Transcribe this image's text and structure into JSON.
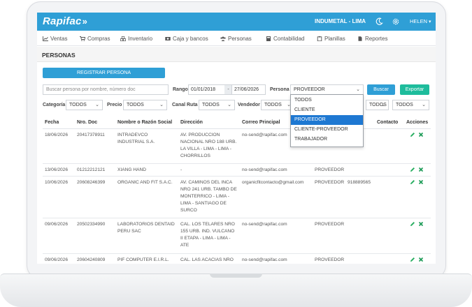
{
  "app": {
    "logo": "Rapifac",
    "company": "INDUMETAL - LIMA",
    "user": "HELEN"
  },
  "nav": [
    {
      "label": "Ventas",
      "icon": "chart-icon"
    },
    {
      "label": "Compras",
      "icon": "cart-icon"
    },
    {
      "label": "Inventario",
      "icon": "boxes-icon"
    },
    {
      "label": "Caja y bancos",
      "icon": "money-icon"
    },
    {
      "label": "Personas",
      "icon": "users-icon"
    },
    {
      "label": "Contabilidad",
      "icon": "calculator-icon"
    },
    {
      "label": "Planillas",
      "icon": "clipboard-icon"
    },
    {
      "label": "Reportes",
      "icon": "document-icon"
    }
  ],
  "page": {
    "title": "PERSONAS"
  },
  "toolbar": {
    "register_label": "REGISTRAR PERSONA",
    "search_placeholder": "Buscar persona por nombre, número doc",
    "range_label": "Rango",
    "date_from": "01/01/2018",
    "date_sep": "-",
    "date_to": "27/06/2026",
    "persona_label": "Persona",
    "persona_value": "PROVEEDOR",
    "search_button": "Buscar",
    "export_button": "Exportar"
  },
  "filters": [
    {
      "label": "Categoría",
      "value": "TODOS"
    },
    {
      "label": "Precio",
      "value": "TODOS"
    },
    {
      "label": "Canal Ruta",
      "value": "TODOS"
    },
    {
      "label": "Vendedor",
      "value": "TODOS"
    },
    {
      "label": "",
      "value": "TODOS"
    },
    {
      "label": "",
      "value": "TODOS"
    }
  ],
  "dropdown": {
    "options": [
      "TODOS",
      "CLIENTE",
      "PROVEEDOR",
      "CLIENTE-PROVEEDOR",
      "TRABAJADOR"
    ],
    "selected": "PROVEEDOR"
  },
  "table": {
    "headers": {
      "fecha": "Fecha",
      "doc": "Nro. Doc",
      "nombre": "Nombre o Razón Social",
      "direccion": "Dirección",
      "correo": "Correo Principal",
      "contacto": "Contacto",
      "acciones": "Acciones"
    },
    "rows": [
      {
        "fecha": "18/06/2026",
        "doc": "20417378911",
        "nombre": [
          "INTRADEVCO",
          "INDUSTRIAL S.A."
        ],
        "direccion": [
          "AV. PRODUCCION",
          "NACIONAL NRO 188 URB.",
          "LA VILLA - LIMA - LIMA -",
          "CHORRILLOS"
        ],
        "correo": "no-send@rapifac.com",
        "tipo": "",
        "telefono": ""
      },
      {
        "fecha": "13/06/2026",
        "doc": "01212212121",
        "nombre": [
          "XIANG HAND"
        ],
        "direccion": [
          "-"
        ],
        "correo": "no-send@rapifac.com",
        "tipo": "PROVEEDOR",
        "telefono": ""
      },
      {
        "fecha": "10/06/2026",
        "doc": "20608246399",
        "nombre": [
          "ORGANIC AND FIT S.A.C."
        ],
        "direccion": [
          "AV. CAMINOS DEL INCA",
          "NRO 241 URB. TAMBO DE",
          "MONTERRICO - LIMA -",
          "LIMA - SANTIAGO DE",
          "SURCO"
        ],
        "correo": "organicfitcontacto@gmail.com",
        "tipo": "PROVEEDOR",
        "telefono": "918889565"
      },
      {
        "fecha": "09/06/2026",
        "doc": "20502334990",
        "nombre": [
          "LABORATORIOS DENTAID",
          "PERU SAC"
        ],
        "direccion": [
          "CAL. LOS TELARES NRO",
          "155 URB. IND. VULCANO",
          "II ETAPA - LIMA - LIMA -",
          "ATE"
        ],
        "correo": "no-send@rapifac.com",
        "tipo": "PROVEEDOR",
        "telefono": ""
      },
      {
        "fecha": "09/06/2026",
        "doc": "20604240809",
        "nombre": [
          "PIF COMPUTER E.I.R.L."
        ],
        "direccion": [
          "CAL. LAS ACACIAS NRO"
        ],
        "correo": "no-send@rapifac.com",
        "tipo": "PROVEEDOR",
        "telefono": ""
      }
    ]
  },
  "colors": {
    "brand": "#2f9fd6",
    "export": "#1ebc9c",
    "edit": "#27ae60",
    "delete": "#1a9a55",
    "dropdown_selected": "#1e78d2"
  }
}
